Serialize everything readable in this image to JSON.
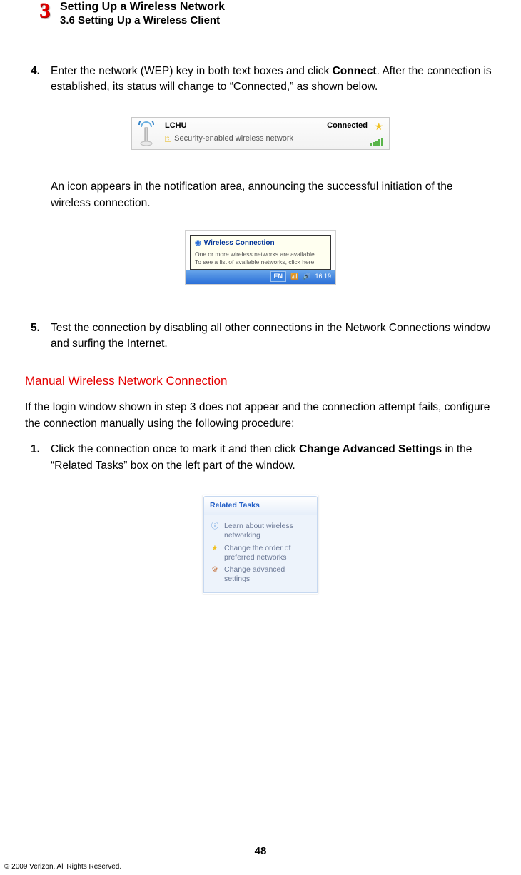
{
  "header": {
    "chapter_number": "3",
    "chapter_title": "Setting Up a Wireless Network",
    "section_label": "3.6  Setting Up a Wireless Client"
  },
  "step4": {
    "num": "4.",
    "pre": "Enter the network (WEP) key in both text boxes and click ",
    "bold": "Connect",
    "post": ". After the connection is established, its status will change to “Connected,” as shown below."
  },
  "fig1": {
    "ssid": "LCHU",
    "status": "Connected",
    "security_line": "Security-enabled wireless network"
  },
  "after_fig1": "An icon appears in the notification area, announcing the successful initiation of the wireless connection.",
  "fig2": {
    "balloon_title": "Wireless Connection",
    "balloon_line1": "One or more wireless networks are available.",
    "balloon_line2": "To see a list of available networks, click here.",
    "lang": "EN",
    "clock": "16:19"
  },
  "step5": {
    "num": "5.",
    "text": "Test the connection by disabling all other connections in the Network Connections window and surfing the Internet."
  },
  "subhead": "Manual Wireless Network Connection",
  "manual_intro": "If the login window shown in step 3 does not appear and the connection attempt fails, configure the connection manually using the following procedure:",
  "mstep1": {
    "num": "1.",
    "pre": "Click the connection once to mark it and then click ",
    "bold": "Change Advanced Settings",
    "post": " in the “Related Tasks” box on the left part of the window."
  },
  "fig3": {
    "header": "Related Tasks",
    "item1": "Learn about wireless networking",
    "item2": "Change the order of preferred networks",
    "item3": "Change advanced settings"
  },
  "page_number": "48",
  "copyright": "© 2009 Verizon. All Rights Reserved."
}
